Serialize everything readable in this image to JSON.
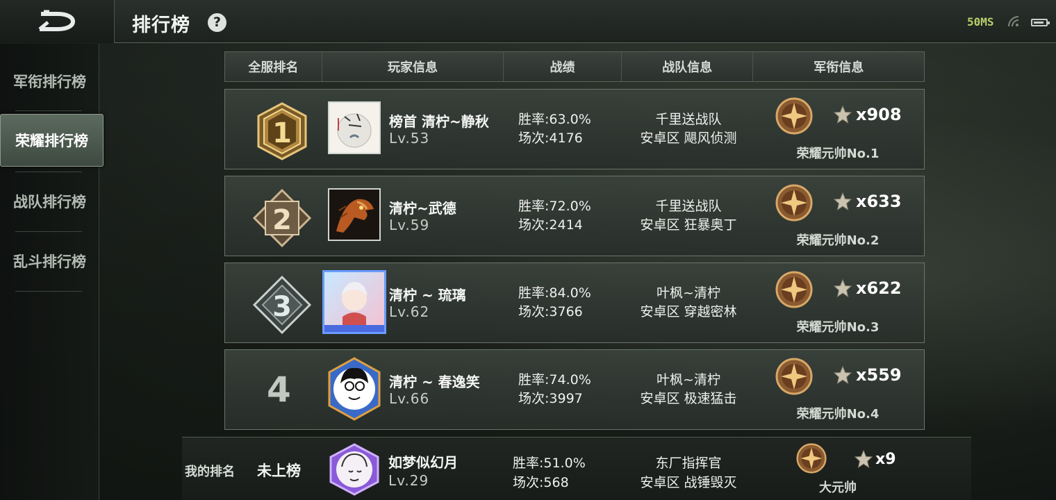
{
  "header": {
    "title": "排行榜",
    "help": "?",
    "ping": "50MS"
  },
  "sidebar": {
    "items": [
      {
        "label": "军衔排行榜"
      },
      {
        "label": "荣耀排行榜"
      },
      {
        "label": "战队排行榜"
      },
      {
        "label": "乱斗排行榜"
      }
    ],
    "active_index": 1
  },
  "table": {
    "columns": [
      "全服排名",
      "玩家信息",
      "战绩",
      "战队信息",
      "军衔信息"
    ],
    "rows": [
      {
        "rank": "1",
        "name": "榜首 清柠~静秋",
        "level": "Lv.53",
        "win_rate": "胜率:63.0%",
        "games": "场次:4176",
        "team": "千里送战队",
        "team_sub": "安卓区 飓风侦测",
        "stars": "x908",
        "mil_title": "荣耀元帅No.1"
      },
      {
        "rank": "2",
        "name": "清柠~武德",
        "level": "Lv.59",
        "win_rate": "胜率:72.0%",
        "games": "场次:2414",
        "team": "千里送战队",
        "team_sub": "安卓区 狂暴奥丁",
        "stars": "x633",
        "mil_title": "荣耀元帅No.2"
      },
      {
        "rank": "3",
        "name": "清柠 ~ 琉璃",
        "level": "Lv.62",
        "win_rate": "胜率:84.0%",
        "games": "场次:3766",
        "team": "叶枫~清柠",
        "team_sub": "安卓区 穿越密林",
        "stars": "x622",
        "mil_title": "荣耀元帅No.3"
      },
      {
        "rank": "4",
        "name": "清柠 ~ 春逸笑",
        "level": "Lv.66",
        "win_rate": "胜率:74.0%",
        "games": "场次:3997",
        "team": "叶枫~清柠",
        "team_sub": "安卓区 极速猛击",
        "stars": "x559",
        "mil_title": "荣耀元帅No.4"
      }
    ]
  },
  "my_rank": {
    "label": "我的排名",
    "rank": "未上榜",
    "name": "如梦似幻月",
    "level": "Lv.29",
    "win_rate": "胜率:51.0%",
    "games": "场次:568",
    "team": "东厂指挥官",
    "team_sub": "安卓区 战锤毁灭",
    "stars": "x9",
    "mil_title": "大元帅"
  },
  "colors": {
    "gold": "#c9a25a",
    "accent_green": "#b8cf6a"
  }
}
